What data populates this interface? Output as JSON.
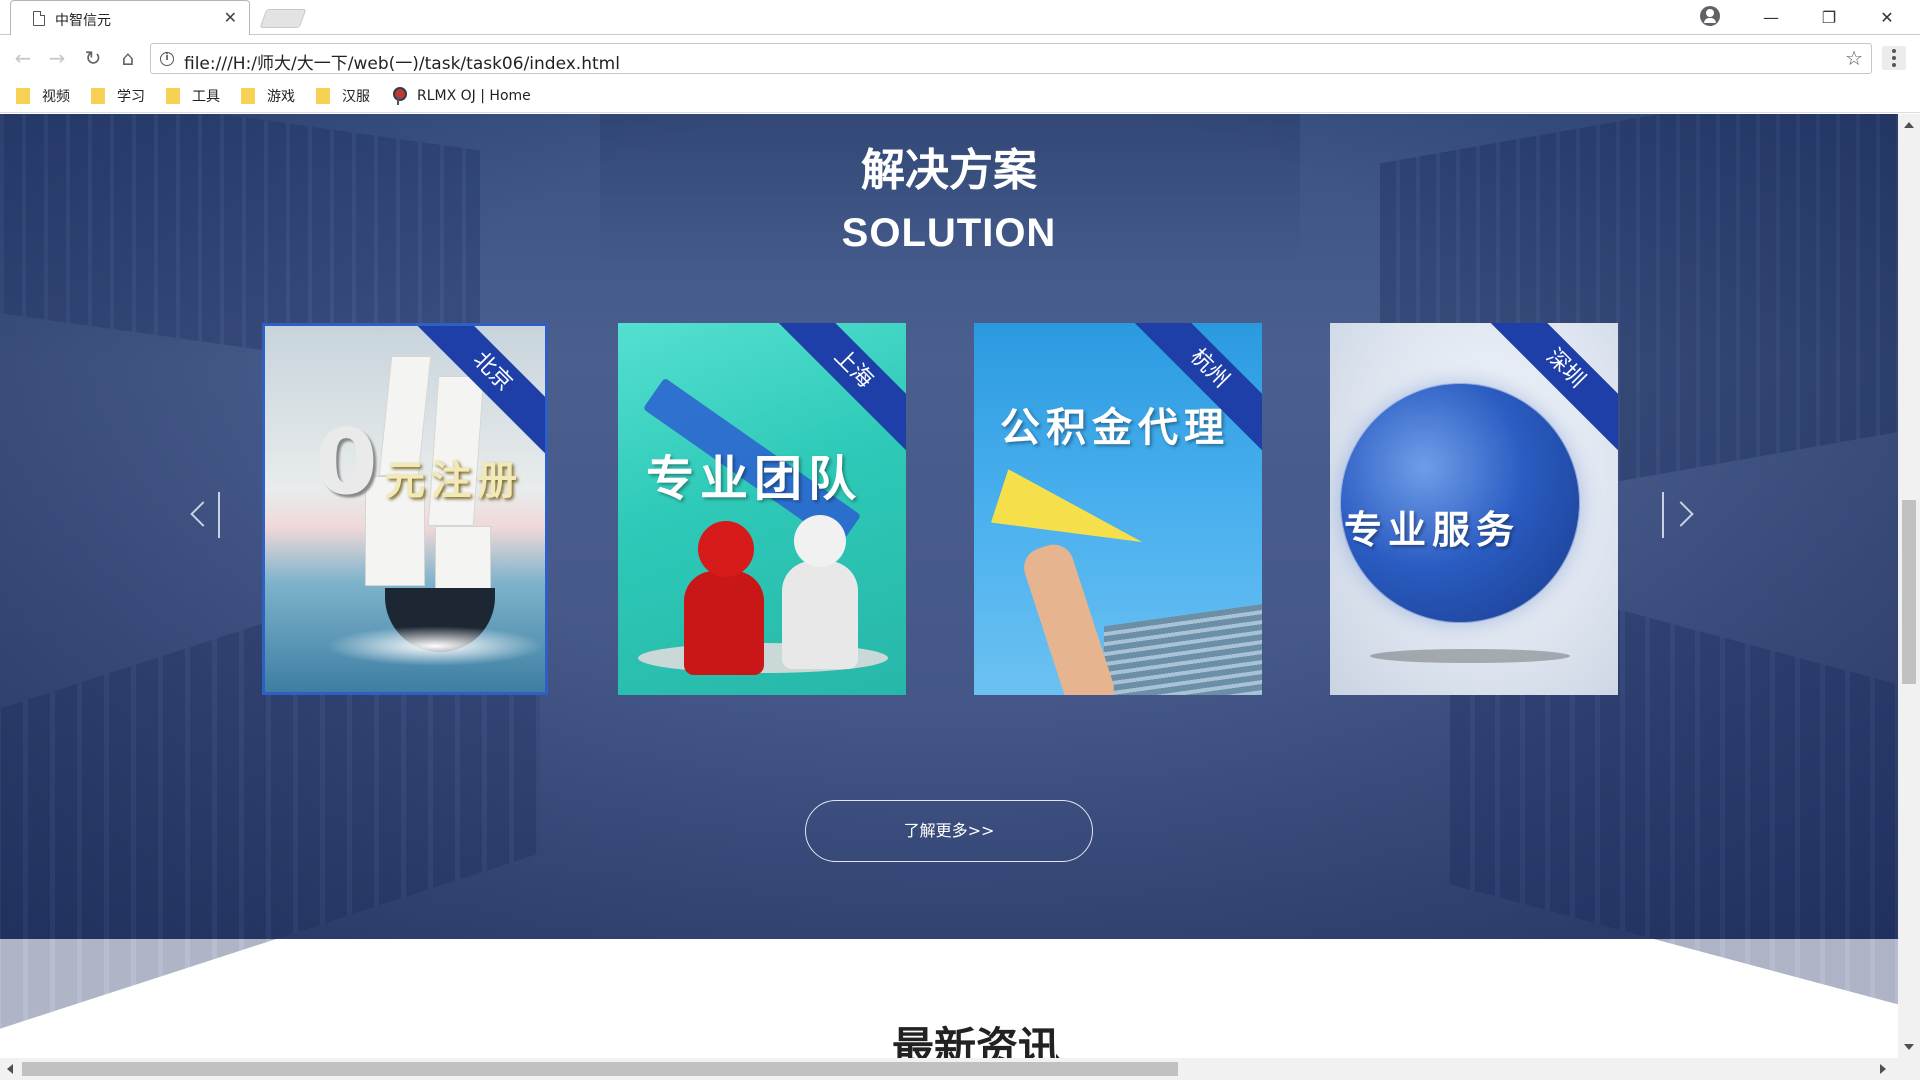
{
  "browser": {
    "tab_title": "中智信元",
    "url": "file:///H:/师大/大一下/web(一)/task/task06/index.html",
    "bookmarks": [
      {
        "label": "视频",
        "icon": "folder-icon"
      },
      {
        "label": "学习",
        "icon": "folder-icon"
      },
      {
        "label": "工具",
        "icon": "folder-icon"
      },
      {
        "label": "游戏",
        "icon": "folder-icon"
      },
      {
        "label": "汉服",
        "icon": "folder-icon"
      },
      {
        "label": "RLMX OJ | Home",
        "icon": "pin-icon"
      }
    ]
  },
  "solution": {
    "title_cn": "解决方案",
    "title_en": "SOLUTION",
    "cards": [
      {
        "city": "北京",
        "slogan": "元注册",
        "prefix": "0"
      },
      {
        "city": "上海",
        "slogan": "专业团队"
      },
      {
        "city": "杭州",
        "slogan": "公积金代理"
      },
      {
        "city": "深圳",
        "slogan": "专业服务"
      }
    ],
    "more_label": "了解更多>>"
  },
  "news": {
    "title": "最新资讯"
  },
  "colors": {
    "hero_bg": "#46598a",
    "ribbon": "#1f3fa8",
    "card_highlight_border": "#2f5fc4"
  }
}
